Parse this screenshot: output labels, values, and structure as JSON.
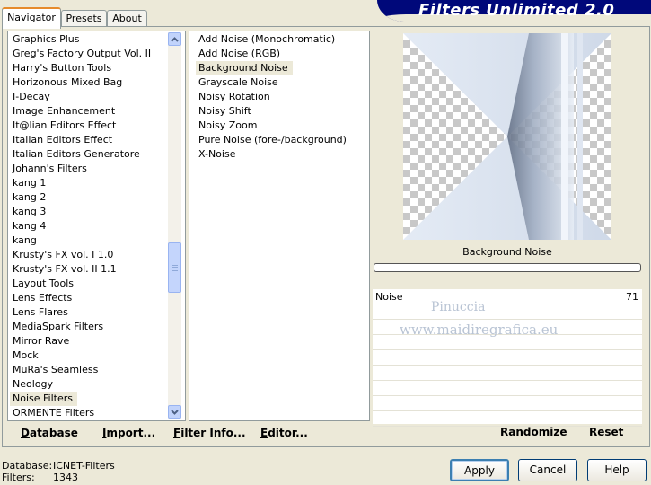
{
  "app": {
    "title": "Filters Unlimited 2.0"
  },
  "tabs": [
    {
      "label": "Navigator",
      "active": true
    },
    {
      "label": "Presets",
      "active": false
    },
    {
      "label": "About",
      "active": false
    }
  ],
  "categories": [
    "Graphics Plus",
    "Greg's Factory Output Vol. II",
    "Harry's Button Tools",
    "Horizonous Mixed Bag",
    "I-Decay",
    "Image Enhancement",
    "It@lian Editors Effect",
    "Italian Editors Effect",
    "Italian Editors Generatore",
    "Johann's Filters",
    "kang 1",
    "kang 2",
    "kang 3",
    "kang 4",
    "kang",
    "Krusty's FX vol. I 1.0",
    "Krusty's FX vol. II 1.1",
    "Layout Tools",
    "Lens Effects",
    "Lens Flares",
    "MediaSpark Filters",
    "Mirror Rave",
    "Mock",
    "MuRa's Seamless",
    "Neology",
    "Noise Filters",
    "ORMENTE Filters"
  ],
  "selected_category": "Noise Filters",
  "filters": [
    "Add Noise (Monochromatic)",
    "Add Noise (RGB)",
    "Background Noise",
    "Grayscale Noise",
    "Noisy Rotation",
    "Noisy Shift",
    "Noisy Zoom",
    "Pure Noise (fore-/background)",
    "X-Noise"
  ],
  "selected_filter": "Background Noise",
  "nav_buttons": {
    "database": "Database",
    "import": "Import...",
    "filter_info": "Filter Info...",
    "editor": "Editor..."
  },
  "preview": {
    "filter_name": "Background Noise"
  },
  "parameter": {
    "name": "Noise",
    "value": "71"
  },
  "action_buttons": {
    "randomize": "Randomize",
    "reset": "Reset"
  },
  "watermark": {
    "line1": "Pinuccia",
    "line2": "www.maidiregrafica.eu"
  },
  "status": {
    "database_label": "Database:",
    "database_value": "ICNET-Filters",
    "filters_label": "Filters:",
    "filters_value": "1343"
  },
  "dialog_buttons": {
    "apply": "Apply",
    "cancel": "Cancel",
    "help": "Help"
  },
  "colors": {
    "banner": "#00087a",
    "background": "#ece9d8",
    "tab_accent": "#e68b2c"
  }
}
